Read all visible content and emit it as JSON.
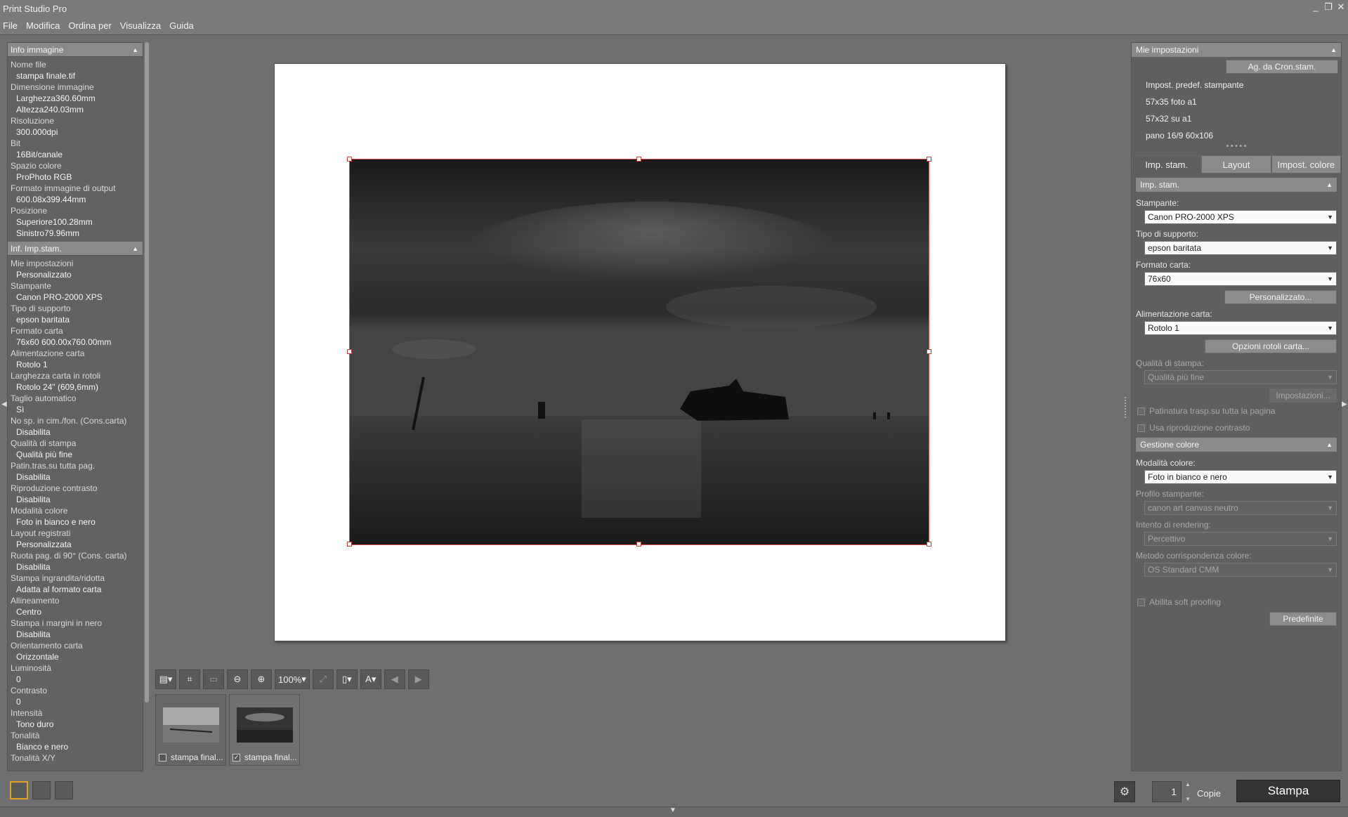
{
  "app": {
    "title": "Print Studio Pro"
  },
  "window_controls": {
    "minimize": "_",
    "restore": "❐",
    "close": "✕"
  },
  "menu": [
    "File",
    "Modifica",
    "Ordina per",
    "Visualizza",
    "Guida"
  ],
  "left": {
    "image_info": {
      "header": "Info immagine",
      "items": [
        {
          "label": "Nome file",
          "values": [
            "stampa finale.tif"
          ]
        },
        {
          "label": "Dimensione immagine",
          "values": [
            "Larghezza360.60mm",
            "Altezza240.03mm"
          ]
        },
        {
          "label": "Risoluzione",
          "values": [
            "300.000dpi"
          ]
        },
        {
          "label": "Bit",
          "values": [
            "16Bit/canale"
          ]
        },
        {
          "label": "Spazio colore",
          "values": [
            "ProPhoto RGB"
          ]
        },
        {
          "label": "Formato immagine di output",
          "values": [
            "600.08x399.44mm"
          ]
        },
        {
          "label": "Posizione",
          "values": [
            "Superiore100.28mm",
            "Sinistro79.96mm"
          ]
        }
      ]
    },
    "print_info": {
      "header": "Inf. Imp.stam.",
      "items": [
        {
          "label": "Mie impostazioni",
          "values": [
            "Personalizzato"
          ]
        },
        {
          "label": "Stampante",
          "values": [
            "Canon PRO-2000 XPS"
          ]
        },
        {
          "label": "Tipo di supporto",
          "values": [
            "epson baritata"
          ]
        },
        {
          "label": "Formato carta",
          "values": [
            "76x60 600.00x760.00mm"
          ]
        },
        {
          "label": "Alimentazione carta",
          "values": [
            "Rotolo 1"
          ]
        },
        {
          "label": "Larghezza carta in rotoli",
          "values": [
            "Rotolo 24\" (609,6mm)"
          ]
        },
        {
          "label": "Taglio automatico",
          "values": [
            "Sì"
          ]
        },
        {
          "label": "No sp. in cim./fon. (Cons.carta)",
          "values": [
            "Disabilita"
          ]
        },
        {
          "label": "Qualità di stampa",
          "values": [
            "Qualità più fine"
          ]
        },
        {
          "label": "Patin.tras.su tutta pag.",
          "values": [
            "Disabilita"
          ]
        },
        {
          "label": "Riproduzione contrasto",
          "values": [
            "Disabilita"
          ]
        },
        {
          "label": "Modalità colore",
          "values": [
            "Foto in bianco e nero"
          ]
        },
        {
          "label": "Layout registrati",
          "values": [
            "Personalizzata"
          ]
        },
        {
          "label": "Ruota pag. di 90° (Cons. carta)",
          "values": [
            "Disabilita"
          ]
        },
        {
          "label": "Stampa ingrandita/ridotta",
          "values": [
            "Adatta al formato carta"
          ]
        },
        {
          "label": "Allineamento",
          "values": [
            "Centro"
          ]
        },
        {
          "label": "Stampa i margini in nero",
          "values": [
            "Disabilita"
          ]
        },
        {
          "label": "Orientamento carta",
          "values": [
            "Orizzontale"
          ]
        },
        {
          "label": "Luminosità",
          "values": [
            "0"
          ]
        },
        {
          "label": "Contrasto",
          "values": [
            "0"
          ]
        },
        {
          "label": "Intensità",
          "values": [
            "Tono duro"
          ]
        },
        {
          "label": "Tonalità",
          "values": [
            "Bianco e nero"
          ]
        },
        {
          "label": "Tonalità X/Y",
          "values": []
        }
      ]
    }
  },
  "toolbar": {
    "zoom": "100%"
  },
  "thumbnails": [
    {
      "name": "stampa final...",
      "checked": false,
      "mark": ""
    },
    {
      "name": "stampa final...",
      "checked": true,
      "mark": "✓"
    }
  ],
  "right": {
    "my_settings_header": "Mie impostazioni",
    "add_button": "Ag. da Cron.stam.",
    "presets": [
      "Impost. predef. stampante",
      "57x35 foto a1",
      "57x32 su a1",
      "pano 16/9 60x106"
    ],
    "tabs": [
      "Imp. stam.",
      "Layout",
      "Impost. colore"
    ],
    "print_section_header": "Imp. stam.",
    "printer_label": "Stampante:",
    "printer_value": "Canon PRO-2000 XPS",
    "media_label": "Tipo di supporto:",
    "media_value": "epson baritata",
    "paper_size_label": "Formato carta:",
    "paper_size_value": "76x60",
    "custom_button": "Personalizzato...",
    "paper_source_label": "Alimentazione carta:",
    "paper_source_value": "Rotolo 1",
    "roll_options_button": "Opzioni rotoli carta...",
    "quality_label": "Qualità di stampa:",
    "quality_value": "Qualità più fine",
    "settings_button": "Impostazioni...",
    "check_coating": "Patinatura trasp.su tutta la pagina",
    "check_contrast": "Usa riproduzione contrasto",
    "color_section_header": "Gestione colore",
    "color_mode_label": "Modalità colore:",
    "color_mode_value": "Foto in bianco e nero",
    "profile_label": "Profilo stampante:",
    "profile_value": "canon art canvas neutro",
    "intent_label": "Intento di rendering:",
    "intent_value": "Percettivo",
    "matching_label": "Metodo corrispondenza colore:",
    "matching_value": "OS Standard CMM",
    "soft_proof": "Abilita soft proofing",
    "defaults_button": "Predefinite"
  },
  "bottom": {
    "copies_value": "1",
    "copies_label": "Copie",
    "print_button": "Stampa"
  }
}
